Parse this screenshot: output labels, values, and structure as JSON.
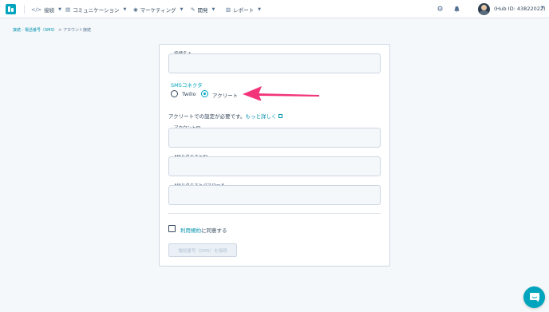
{
  "topnav": {
    "items": [
      {
        "label": "接続",
        "icon": "code-icon"
      },
      {
        "label": "コミュニケーション",
        "icon": "chat-icon"
      },
      {
        "label": "マーケティング",
        "icon": "broadcast-icon"
      },
      {
        "label": "開発",
        "icon": "wrench-icon"
      },
      {
        "label": "レポート",
        "icon": "bar-chart-icon"
      }
    ],
    "hub_id": "(Hub ID: 43822022)"
  },
  "breadcrumb": {
    "parent": "接続 - 電話番号（SMS）",
    "separator": ">",
    "current": "アカウント接続"
  },
  "form": {
    "connection_name_label": "接続名 *",
    "sms_connector_label": "SMSコネクタ",
    "connector_options": [
      {
        "label": "Twilio",
        "selected": false
      },
      {
        "label": "アクリート",
        "selected": true
      }
    ],
    "setup_note": "アクリートでの設定が必要です。",
    "learn_more_link": "もっと詳しく",
    "account_id_label": "アカウントID",
    "api_request_id_label": "APIリクエストID",
    "api_request_password_label": "APIリクエストパスワード",
    "terms_link": "利用規約",
    "terms_suffix": "に同意する",
    "connect_button": "電話番号（SMS）を接続"
  },
  "colors": {
    "accent": "#00a4bd",
    "link": "#0091ae",
    "annotation_arrow": "#f2357a"
  }
}
